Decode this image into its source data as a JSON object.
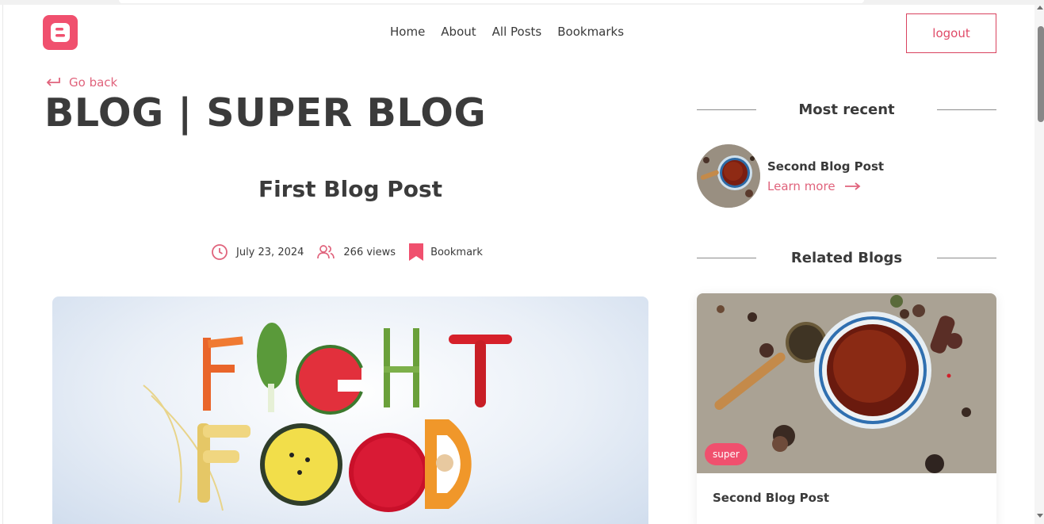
{
  "header": {
    "logo_icon": "blogger-logo-icon",
    "nav": [
      {
        "label": "Home"
      },
      {
        "label": "About"
      },
      {
        "label": "All Posts"
      },
      {
        "label": "Bookmarks"
      }
    ],
    "logout_label": "logout"
  },
  "go_back": {
    "label": "Go back",
    "icon": "arrow-return-left-icon"
  },
  "blog_title": "BLOG | SUPER BLOG",
  "post": {
    "title": "First Blog Post",
    "date": "July 23, 2024",
    "views": "266 views",
    "bookmark_label": "Bookmark",
    "hero_image_text": [
      "FIGHT",
      "FOOD"
    ]
  },
  "sidebar": {
    "most_recent": {
      "heading": "Most recent",
      "item_title": "Second Blog Post",
      "learn_more": "Learn more"
    },
    "related": {
      "heading": "Related Blogs",
      "card_tag": "super",
      "card_title": "Second Blog Post"
    }
  },
  "colors": {
    "accent": "#f0506e",
    "accent_text": "#e0637c",
    "text": "#3a3a3a",
    "divider": "#8c8c8c"
  }
}
